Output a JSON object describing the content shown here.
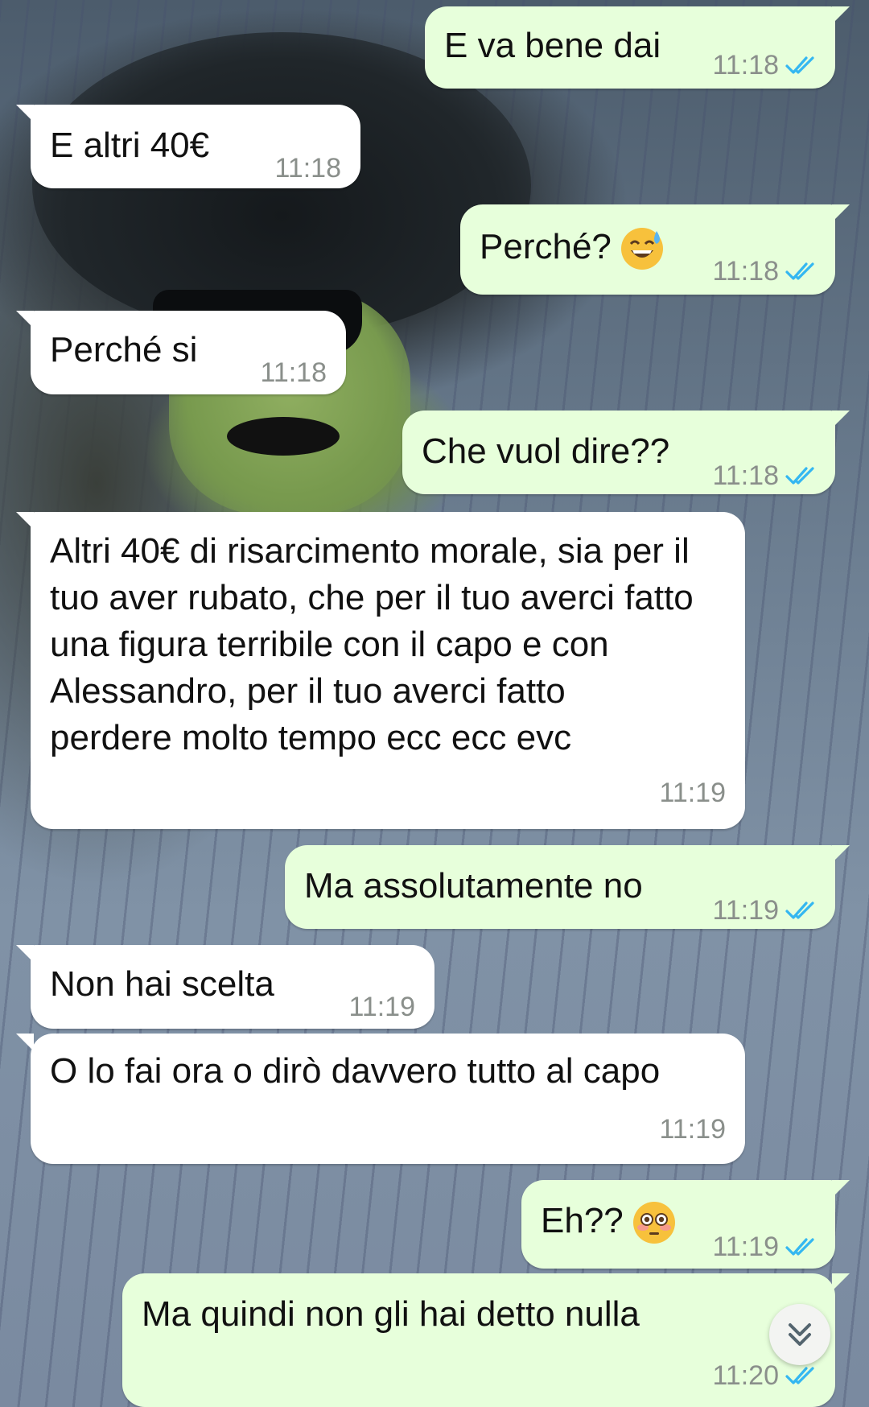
{
  "messages": [
    {
      "side": "out",
      "text": "E va bene dai",
      "time": "11:18",
      "read": true
    },
    {
      "side": "in",
      "text": "E altri 40€",
      "time": "11:18"
    },
    {
      "side": "out",
      "text": "Perché?",
      "emoji": "sweat-smile-emoji",
      "time": "11:18",
      "read": true
    },
    {
      "side": "in",
      "text": "Perché si",
      "time": "11:18"
    },
    {
      "side": "out",
      "text": "Che vuol dire??",
      "time": "11:18",
      "read": true
    },
    {
      "side": "in",
      "text": "Altri 40€ di risarcimento morale, sia per il tuo aver rubato, che per il tuo averci fatto una figura terribile con il capo e con Alessandro, per il tuo averci fatto perdere molto tempo ecc ecc evc",
      "time": "11:19"
    },
    {
      "side": "out",
      "text": "Ma assolutamente no",
      "time": "11:19",
      "read": true
    },
    {
      "side": "in",
      "text": "Non hai scelta",
      "time": "11:19"
    },
    {
      "side": "in",
      "text": "O lo fai ora o dirò davvero tutto al capo",
      "time": "11:19"
    },
    {
      "side": "out",
      "text": "Eh??",
      "emoji": "flushed-emoji",
      "time": "11:19",
      "read": true
    },
    {
      "side": "out",
      "text": "Ma quindi non gli hai detto nulla",
      "time": "11:20",
      "read": true
    }
  ],
  "colors": {
    "incoming_bubble": "#ffffff",
    "outgoing_bubble": "#e7ffdb",
    "read_ticks": "#34b7f1",
    "timestamp": "#8a8f8b"
  },
  "scroll_button": {
    "icon": "double-chevron-down-icon"
  }
}
